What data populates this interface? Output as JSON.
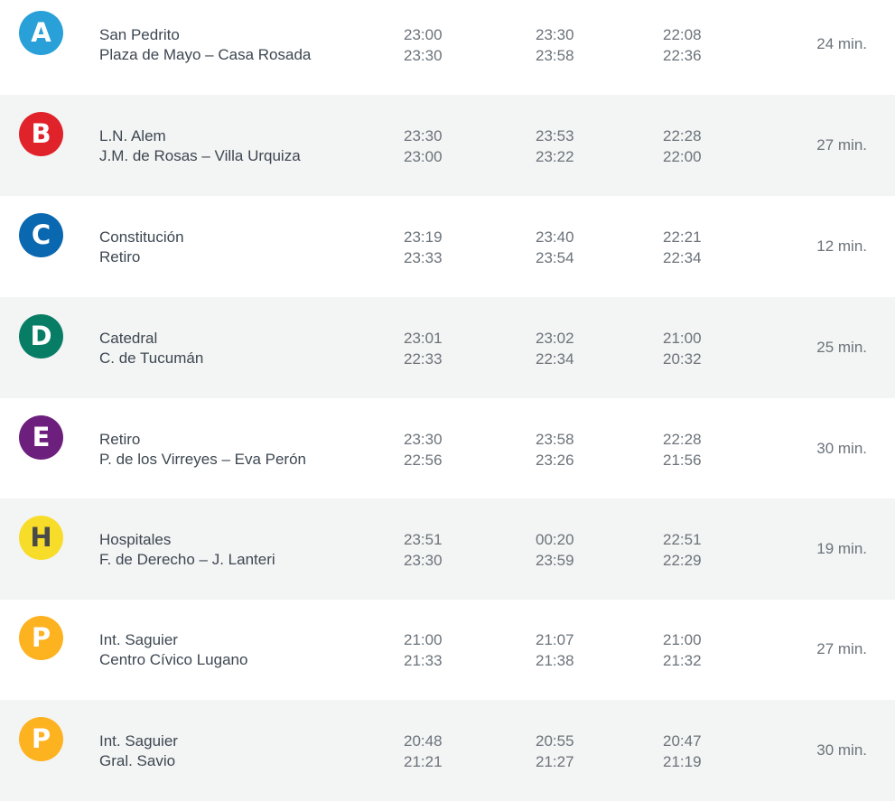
{
  "colors": {
    "A": "#2aa0d8",
    "B": "#e0222a",
    "C": "#0a68b0",
    "D": "#087d65",
    "E": "#6d1f7d",
    "H": "#f7dd2a",
    "P": "#fdb21f"
  },
  "lines": [
    {
      "letter": "A",
      "badge_color": "#2aa0d8",
      "letter_color": "#ffffff",
      "station_from": "San Pedrito",
      "station_to": "Plaza de Mayo – Casa Rosada",
      "col1": [
        "23:00",
        "23:30"
      ],
      "col2": [
        "23:30",
        "23:58"
      ],
      "col3": [
        "22:08",
        "22:36"
      ],
      "duration": "24 min."
    },
    {
      "letter": "B",
      "badge_color": "#e0222a",
      "letter_color": "#ffffff",
      "station_from": "L.N. Alem",
      "station_to": "J.M. de Rosas – Villa Urquiza",
      "col1": [
        "23:30",
        "23:00"
      ],
      "col2": [
        "23:53",
        "23:22"
      ],
      "col3": [
        "22:28",
        "22:00"
      ],
      "duration": "27 min."
    },
    {
      "letter": "C",
      "badge_color": "#0a68b0",
      "letter_color": "#ffffff",
      "station_from": "Constitución",
      "station_to": "Retiro",
      "col1": [
        "23:19",
        "23:33"
      ],
      "col2": [
        "23:40",
        "23:54"
      ],
      "col3": [
        "22:21",
        "22:34"
      ],
      "duration": "12 min."
    },
    {
      "letter": "D",
      "badge_color": "#087d65",
      "letter_color": "#ffffff",
      "station_from": "Catedral",
      "station_to": "C. de Tucumán",
      "col1": [
        "23:01",
        "22:33"
      ],
      "col2": [
        "23:02",
        "22:34"
      ],
      "col3": [
        "21:00",
        "20:32"
      ],
      "duration": "25 min."
    },
    {
      "letter": "E",
      "badge_color": "#6d1f7d",
      "letter_color": "#ffffff",
      "station_from": "Retiro",
      "station_to": "P. de los Virreyes – Eva Perón",
      "col1": [
        "23:30",
        "22:56"
      ],
      "col2": [
        "23:58",
        "23:26"
      ],
      "col3": [
        "22:28",
        "21:56"
      ],
      "duration": "30 min."
    },
    {
      "letter": "H",
      "badge_color": "#f7dd2a",
      "letter_color": "#4a4a4a",
      "station_from": "Hospitales",
      "station_to": "F. de Derecho – J. Lanteri",
      "col1": [
        "23:51",
        "23:30"
      ],
      "col2": [
        "00:20",
        "23:59"
      ],
      "col3": [
        "22:51",
        "22:29"
      ],
      "duration": "19 min."
    },
    {
      "letter": "P",
      "badge_color": "#fdb21f",
      "letter_color": "#ffffff",
      "station_from": "Int. Saguier",
      "station_to": "Centro Cívico Lugano",
      "col1": [
        "21:00",
        "21:33"
      ],
      "col2": [
        "21:07",
        "21:38"
      ],
      "col3": [
        "21:00",
        "21:32"
      ],
      "duration": "27 min."
    },
    {
      "letter": "P",
      "badge_color": "#fdb21f",
      "letter_color": "#ffffff",
      "station_from": "Int. Saguier",
      "station_to": "Gral. Savio",
      "col1": [
        "20:48",
        "21:21"
      ],
      "col2": [
        "20:55",
        "21:27"
      ],
      "col3": [
        "20:47",
        "21:19"
      ],
      "duration": "30 min."
    }
  ]
}
